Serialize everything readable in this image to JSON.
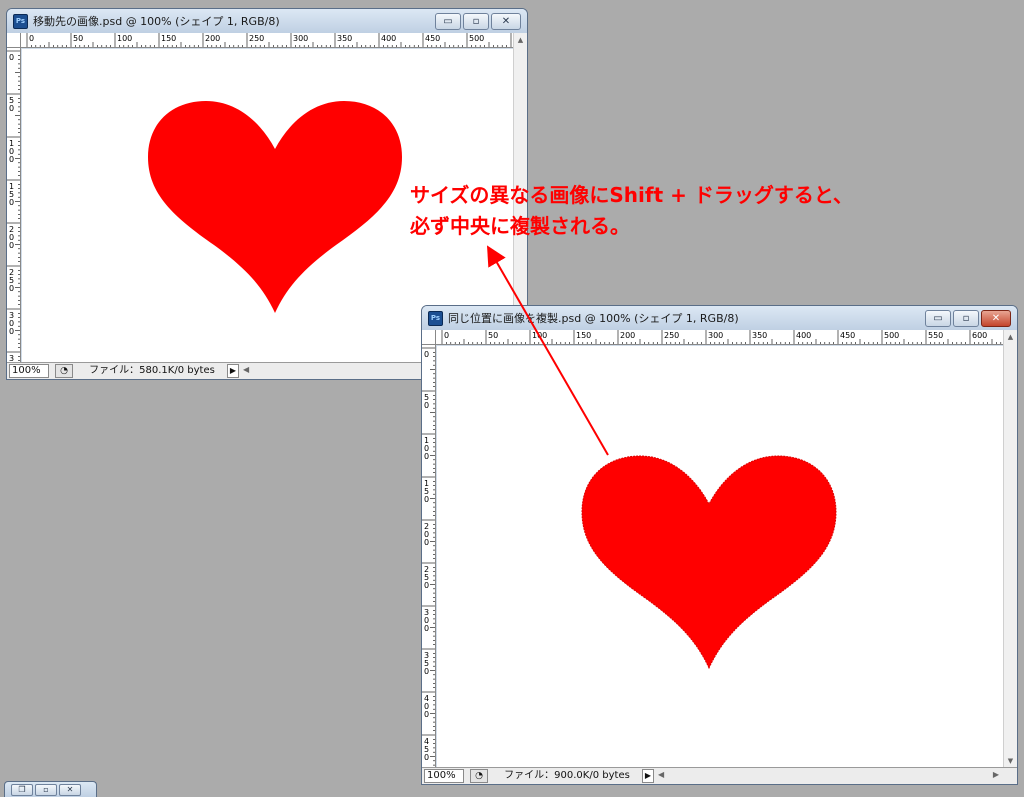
{
  "window1": {
    "title": "移動先の画像.psd @ 100% (シェイプ 1, RGB/8)",
    "zoom": "100%",
    "file_info": "ファイル：580.1K/0 bytes",
    "ruler_h_labels": [
      "0",
      "50",
      "100",
      "150",
      "200",
      "250",
      "300",
      "350",
      "400",
      "450",
      "500"
    ],
    "ruler_v_labels": [
      "0",
      "5\n0",
      "1\n0\n0",
      "1\n5\n0",
      "2\n0\n0",
      "2\n5\n0",
      "3\n0\n0",
      "3"
    ]
  },
  "window2": {
    "title": "同じ位置に画像を複製.psd @ 100% (シェイプ 1, RGB/8)",
    "zoom": "100%",
    "file_info": "ファイル：900.0K/0 bytes",
    "ruler_h_labels": [
      "0",
      "50",
      "100",
      "150",
      "200",
      "250",
      "300",
      "350",
      "400",
      "450",
      "500",
      "550",
      "600"
    ],
    "ruler_v_labels": [
      "0",
      "5\n0",
      "1\n0\n0",
      "1\n5\n0",
      "2\n0\n0",
      "2\n5\n0",
      "3\n0\n0",
      "3\n5\n0",
      "4\n0\n0",
      "4\n5\n0"
    ]
  },
  "controls": {
    "minimize": "▭",
    "maximize": "▫",
    "close": "✕",
    "restore": "❐"
  },
  "annotation": {
    "line1": "サイズの異なる画像にShift + ドラッグすると、",
    "line2": "必ず中央に複製される。"
  },
  "icons": {
    "app": "Ps",
    "preview": "◔",
    "menu_arrow": "▶",
    "scroll_left": "◀",
    "scroll_up": "▲",
    "scroll_down": "▼",
    "scroll_right": "▶"
  },
  "colors": {
    "heart": "#ff0000",
    "annotation": "#ff0000",
    "desktop": "#ababab"
  }
}
